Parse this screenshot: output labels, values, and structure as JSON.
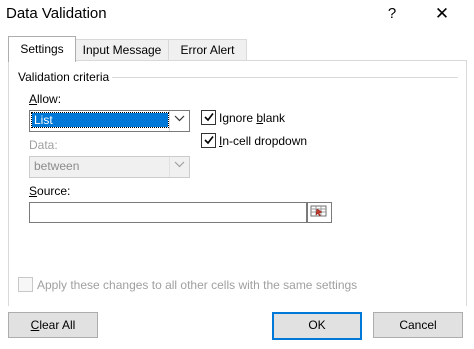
{
  "window": {
    "title": "Data Validation",
    "help_glyph": "?",
    "close_glyph": "✕"
  },
  "tabs": [
    {
      "label": "Settings",
      "active": true
    },
    {
      "label": "Input Message",
      "active": false
    },
    {
      "label": "Error Alert",
      "active": false
    }
  ],
  "settings": {
    "group_label": "Validation criteria",
    "allow": {
      "label_mnemonic": "A",
      "label_rest": "llow:",
      "value": "List"
    },
    "data": {
      "label": "Data:",
      "value": "between",
      "enabled": false
    },
    "ignore_blank": {
      "label_pre": "Ignore ",
      "label_mnemonic": "b",
      "label_post": "lank",
      "checked": true
    },
    "in_cell_dropdown": {
      "label_pre": "",
      "label_mnemonic": "I",
      "label_post": "n-cell dropdown",
      "checked": true
    },
    "source": {
      "label_mnemonic": "S",
      "label_rest": "ource:",
      "value": ""
    },
    "apply_all": {
      "label": "Apply these changes to all other cells with the same settings",
      "checked": false,
      "enabled": false
    }
  },
  "buttons": {
    "clear_all": {
      "mnemonic": "C",
      "rest": "lear All"
    },
    "ok": "OK",
    "cancel": "Cancel"
  },
  "icons": {
    "dropdown": "chevron-down-icon",
    "range": "range-select-icon",
    "check": "checkmark-icon"
  },
  "colors": {
    "accent": "#0078d7",
    "selection": "#0078d7",
    "disabled_text": "#a0a0a0",
    "button_face": "#e1e1e1"
  }
}
